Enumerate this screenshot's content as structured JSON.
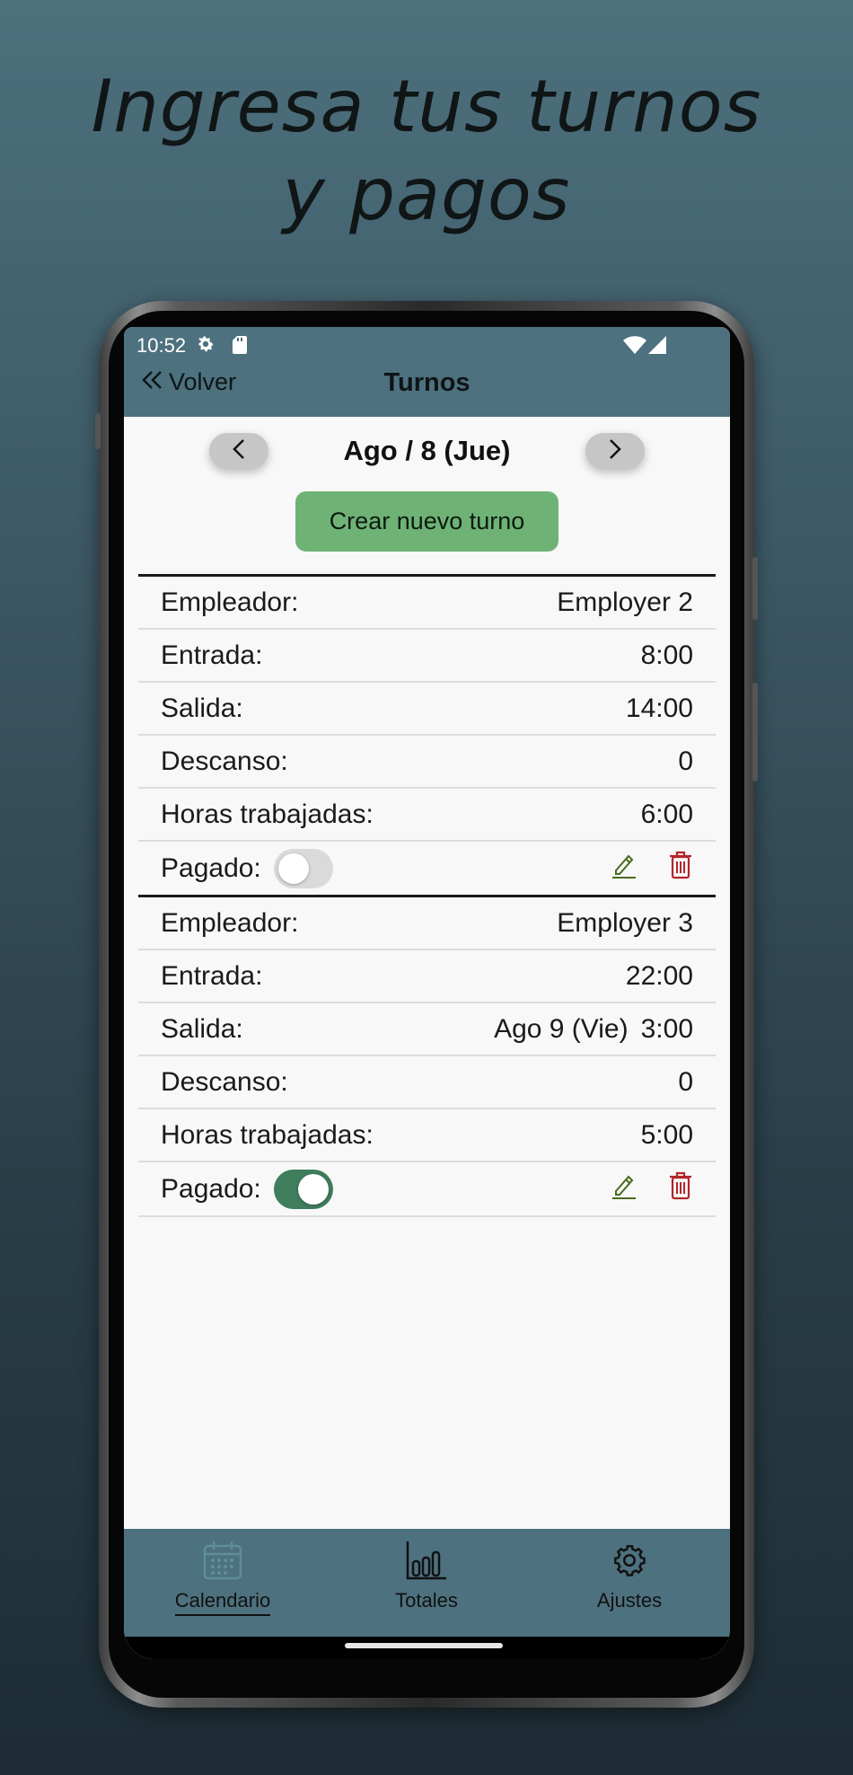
{
  "headline": {
    "line1": "Ingresa tus turnos",
    "line2": "y pagos"
  },
  "status_bar": {
    "time": "10:52"
  },
  "header": {
    "back_label": "Volver",
    "title": "Turnos"
  },
  "date_nav": {
    "date": "Ago / 8 (Jue)"
  },
  "create_button": {
    "label": "Crear nuevo turno"
  },
  "labels": {
    "employer": "Empleador:",
    "entrada": "Entrada:",
    "salida": "Salida:",
    "descanso": "Descanso:",
    "horas": "Horas trabajadas:",
    "pagado": "Pagado:"
  },
  "shifts": [
    {
      "employer": "Employer 2",
      "entrada": "8:00",
      "salida_date": "",
      "salida": "14:00",
      "descanso": "0",
      "horas": "6:00",
      "pagado": false
    },
    {
      "employer": "Employer 3",
      "entrada": "22:00",
      "salida_date": "Ago 9 (Vie)",
      "salida": "3:00",
      "descanso": "0",
      "horas": "5:00",
      "pagado": true
    }
  ],
  "bottom_nav": {
    "calendar": "Calendario",
    "totals": "Totales",
    "settings": "Ajustes"
  },
  "colors": {
    "header": "#4d717e",
    "create_button": "#6fb276",
    "toggle_on": "#3f7d5d",
    "edit_icon": "#4a6b1e",
    "delete_icon": "#b3242a"
  }
}
